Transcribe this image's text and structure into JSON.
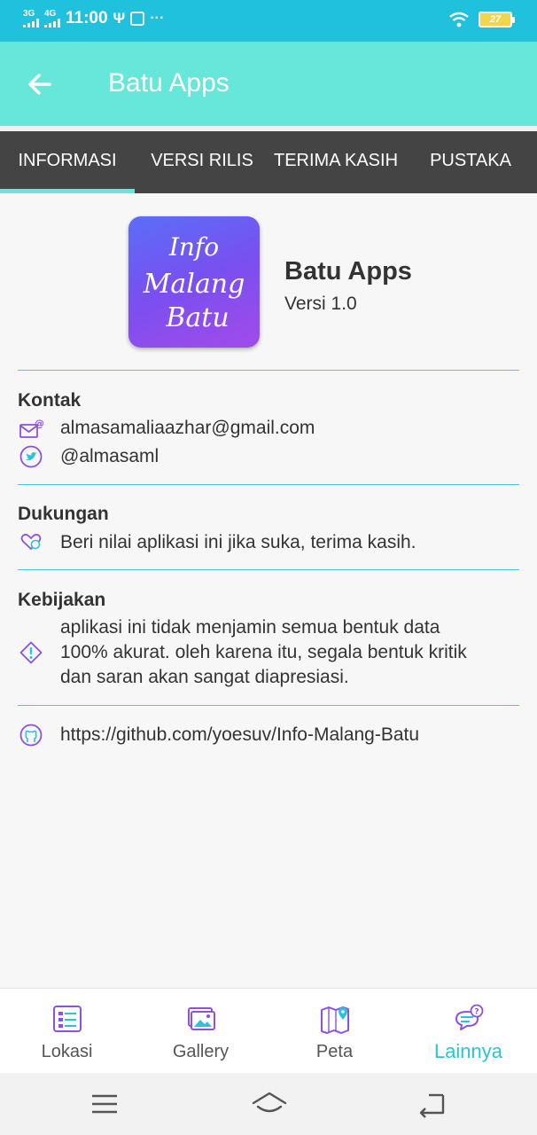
{
  "status_bar": {
    "net1": "3G",
    "net2": "4G",
    "time": "11:00",
    "usb_symbol": "Ψ",
    "more": "···",
    "battery": "27"
  },
  "app_bar": {
    "title": "Batu Apps"
  },
  "tabs": [
    {
      "label": "INFORMASI",
      "active": true
    },
    {
      "label": "VERSI RILIS",
      "active": false
    },
    {
      "label": "TERIMA KASIH",
      "active": false
    },
    {
      "label": "PUSTAKA",
      "active": false
    }
  ],
  "app_info": {
    "icon_text": [
      "Info",
      "Malang",
      "Batu"
    ],
    "name": "Batu Apps",
    "version": "Versi 1.0"
  },
  "contact": {
    "title": "Kontak",
    "email": "almasamaliaazhar@gmail.com",
    "twitter": "@almasaml"
  },
  "support": {
    "title": "Dukungan",
    "text": "Beri nilai aplikasi ini jika suka, terima kasih."
  },
  "policy": {
    "title": "Kebijakan",
    "lines": [
      "aplikasi ini tidak menjamin semua bentuk data",
      "100% akurat. oleh karena itu, segala bentuk kritik",
      "dan saran akan sangat diapresiasi."
    ]
  },
  "repo": {
    "url": "https://github.com/yoesuv/Info-Malang-Batu"
  },
  "bottom_nav": [
    {
      "label": "Lokasi",
      "icon": "list-icon",
      "active": false
    },
    {
      "label": "Gallery",
      "icon": "gallery-icon",
      "active": false
    },
    {
      "label": "Peta",
      "icon": "map-icon",
      "active": false
    },
    {
      "label": "Lainnya",
      "icon": "chat-question-icon",
      "active": true
    }
  ],
  "colors": {
    "status_bar": "#1fc1dd",
    "app_bar": "#67e6da",
    "tab_bar": "#444444",
    "accent": "#2bc3d9",
    "icon_purple": "#8e4fe6"
  }
}
